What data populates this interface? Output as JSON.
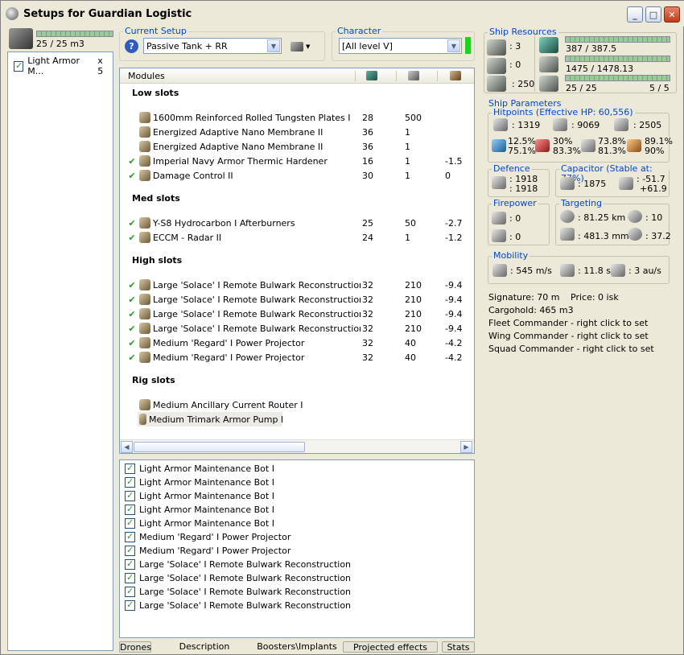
{
  "window": {
    "title": "Setups for Guardian Logistic"
  },
  "left": {
    "capacity": "25 / 25 m3",
    "capacity_fraction": 1.0,
    "items": [
      {
        "label": "Light Armor M...",
        "qty": "x 5"
      }
    ]
  },
  "current_setup": {
    "label": "Current Setup",
    "value": "Passive Tank + RR"
  },
  "character": {
    "label": "Character",
    "value": "[All level V]"
  },
  "modules": {
    "header": "Modules",
    "sections": [
      {
        "title": "Low slots",
        "rows": [
          {
            "checked": false,
            "name": "1600mm Reinforced Rolled Tungsten Plates I",
            "c1": "28",
            "c2": "500",
            "c3": ""
          },
          {
            "checked": false,
            "name": "Energized Adaptive Nano Membrane II",
            "c1": "36",
            "c2": "1",
            "c3": ""
          },
          {
            "checked": false,
            "name": "Energized Adaptive Nano Membrane II",
            "c1": "36",
            "c2": "1",
            "c3": ""
          },
          {
            "checked": true,
            "name": "Imperial Navy Armor Thermic Hardener",
            "c1": "16",
            "c2": "1",
            "c3": "-1.5"
          },
          {
            "checked": true,
            "name": "Damage Control II",
            "c1": "30",
            "c2": "1",
            "c3": "0"
          }
        ]
      },
      {
        "title": "Med slots",
        "rows": [
          {
            "checked": true,
            "name": "Y-S8 Hydrocarbon I Afterburners",
            "c1": "25",
            "c2": "50",
            "c3": "-2.7"
          },
          {
            "checked": true,
            "name": "ECCM - Radar II",
            "c1": "24",
            "c2": "1",
            "c3": "-1.2"
          }
        ]
      },
      {
        "title": "High slots",
        "rows": [
          {
            "checked": true,
            "name": "Large 'Solace' I Remote Bulwark Reconstruction",
            "c1": "32",
            "c2": "210",
            "c3": "-9.4"
          },
          {
            "checked": true,
            "name": "Large 'Solace' I Remote Bulwark Reconstruction",
            "c1": "32",
            "c2": "210",
            "c3": "-9.4"
          },
          {
            "checked": true,
            "name": "Large 'Solace' I Remote Bulwark Reconstruction",
            "c1": "32",
            "c2": "210",
            "c3": "-9.4"
          },
          {
            "checked": true,
            "name": "Large 'Solace' I Remote Bulwark Reconstruction",
            "c1": "32",
            "c2": "210",
            "c3": "-9.4"
          },
          {
            "checked": true,
            "name": "Medium 'Regard' I Power Projector",
            "c1": "32",
            "c2": "40",
            "c3": "-4.2"
          },
          {
            "checked": true,
            "name": "Medium 'Regard' I Power Projector",
            "c1": "32",
            "c2": "40",
            "c3": "-4.2"
          }
        ]
      },
      {
        "title": "Rig slots",
        "rows": [
          {
            "checked": false,
            "name": "Medium Ancillary Current Router I",
            "c1": "",
            "c2": "",
            "c3": ""
          },
          {
            "checked": false,
            "name": "Medium Trimark Armor Pump I",
            "c1": "",
            "c2": "",
            "c3": ""
          }
        ]
      }
    ]
  },
  "drones": [
    "Light Armor Maintenance Bot I",
    "Light Armor Maintenance Bot I",
    "Light Armor Maintenance Bot I",
    "Light Armor Maintenance Bot I",
    "Light Armor Maintenance Bot I",
    "Medium 'Regard' I Power Projector",
    "Medium 'Regard' I Power Projector",
    "Large 'Solace' I Remote Bulwark Reconstruction",
    "Large 'Solace' I Remote Bulwark Reconstruction",
    "Large 'Solace' I Remote Bulwark Reconstruction",
    "Large 'Solace' I Remote Bulwark Reconstruction"
  ],
  "tabs": [
    "Drones",
    "Description",
    "Boosters\\Implants",
    "Projected effects",
    "Stats"
  ],
  "resources": {
    "label": "Ship Resources",
    "turret": ": 3",
    "launcher": ": 0",
    "calibration": ": 250",
    "cpu": "387 / 387.5",
    "cpu_fraction": 0.999,
    "powergrid": "1475 / 1478.13",
    "powergrid_fraction": 0.998,
    "bandwidth": "25 / 25",
    "bandwidth_fraction": 1.0,
    "drones_count": "5 / 5"
  },
  "params": {
    "label": "Ship Parameters",
    "hitpoints_label": "Hitpoints (Effective HP: 60,556)",
    "shield_hp": ": 1319",
    "armor_hp": ": 9069",
    "structure_hp": ": 2505",
    "res1a": "12.5%",
    "res1b": "75.1%",
    "res2a": "30%",
    "res2b": "83.3%",
    "res3a": "73.8%",
    "res3b": "81.3%",
    "res4a": "89.1%",
    "res4b": "90%",
    "defence_label": "Defence",
    "def1": ": 1918",
    "def2": ": 1918",
    "capacitor_label": "Capacitor (Stable at: 77%)",
    "cap_amount": ": 1875",
    "cap_delta1": ": -51.7",
    "cap_delta2": "+61.9",
    "firepower_label": "Firepower",
    "fp1": ": 0",
    "fp2": ": 0",
    "targeting_label": "Targeting",
    "range": ": 81.25 km",
    "targets": ": 10",
    "scan_res": ": 481.3 mm",
    "sensor": ": 37.2",
    "mobility_label": "Mobility",
    "speed": ": 545 m/s",
    "align": ": 11.8 s",
    "warp": ": 3 au/s",
    "signature": "Signature: 70 m",
    "price": "Price: 0 isk",
    "cargohold": "Cargohold: 465 m3",
    "fleet": "Fleet Commander - right click to set",
    "wing": "Wing Commander - right click to set",
    "squad": "Squad Commander - right click to set"
  }
}
